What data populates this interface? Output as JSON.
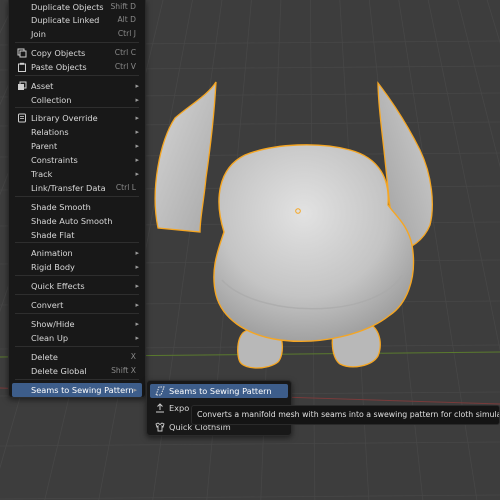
{
  "menu": {
    "items": [
      {
        "label": "Duplicate Objects",
        "shortcut": "Shift D",
        "submenu": false,
        "icon": ""
      },
      {
        "label": "Duplicate Linked",
        "shortcut": "Alt D",
        "submenu": false,
        "icon": ""
      },
      {
        "label": "Join",
        "shortcut": "Ctrl J",
        "submenu": false,
        "icon": ""
      },
      {
        "label": "Copy Objects",
        "shortcut": "Ctrl C",
        "submenu": false,
        "icon": "copy-icon"
      },
      {
        "label": "Paste Objects",
        "shortcut": "Ctrl V",
        "submenu": false,
        "icon": "paste-icon"
      },
      {
        "label": "Asset",
        "shortcut": "",
        "submenu": true,
        "icon": "asset-icon"
      },
      {
        "label": "Collection",
        "shortcut": "",
        "submenu": true,
        "icon": ""
      },
      {
        "label": "Library Override",
        "shortcut": "",
        "submenu": true,
        "icon": "library-icon"
      },
      {
        "label": "Relations",
        "shortcut": "",
        "submenu": true,
        "icon": ""
      },
      {
        "label": "Parent",
        "shortcut": "",
        "submenu": true,
        "icon": ""
      },
      {
        "label": "Constraints",
        "shortcut": "",
        "submenu": true,
        "icon": ""
      },
      {
        "label": "Track",
        "shortcut": "",
        "submenu": true,
        "icon": ""
      },
      {
        "label": "Link/Transfer Data",
        "shortcut": "Ctrl L",
        "submenu": false,
        "icon": ""
      },
      {
        "label": "Shade Smooth",
        "shortcut": "",
        "submenu": false,
        "icon": ""
      },
      {
        "label": "Shade Auto Smooth",
        "shortcut": "",
        "submenu": false,
        "icon": ""
      },
      {
        "label": "Shade Flat",
        "shortcut": "",
        "submenu": false,
        "icon": ""
      },
      {
        "label": "Animation",
        "shortcut": "",
        "submenu": true,
        "icon": ""
      },
      {
        "label": "Rigid Body",
        "shortcut": "",
        "submenu": true,
        "icon": ""
      },
      {
        "label": "Quick Effects",
        "shortcut": "",
        "submenu": true,
        "icon": ""
      },
      {
        "label": "Convert",
        "shortcut": "",
        "submenu": true,
        "icon": ""
      },
      {
        "label": "Show/Hide",
        "shortcut": "",
        "submenu": true,
        "icon": ""
      },
      {
        "label": "Clean Up",
        "shortcut": "",
        "submenu": true,
        "icon": ""
      },
      {
        "label": "Delete",
        "shortcut": "X",
        "submenu": false,
        "icon": ""
      },
      {
        "label": "Delete Global",
        "shortcut": "Shift X",
        "submenu": false,
        "icon": ""
      },
      {
        "label": "Seams to Sewing Pattern",
        "shortcut": "",
        "submenu": true,
        "icon": ""
      }
    ]
  },
  "submenu": {
    "items": [
      {
        "label": "Seams to Sewing Pattern",
        "icon": "sewing-pattern-icon"
      },
      {
        "label": "Expo",
        "icon": "export-icon"
      },
      {
        "label": "Quick Clothsim",
        "icon": "clothsim-icon"
      }
    ]
  },
  "tooltip": {
    "text": "Converts a manifold mesh with seams into a swewing pattern for cloth simulation."
  },
  "colors": {
    "viewport_bg": "#3d3d3d",
    "grid": "#4a4a4a",
    "menu_bg": "#181818",
    "highlight": "#3d5d8a",
    "selection_outline": "#f5a623",
    "mesh": "#c8c8c8",
    "x_axis": "#7a3b3b",
    "y_axis": "#5a7a2e"
  }
}
